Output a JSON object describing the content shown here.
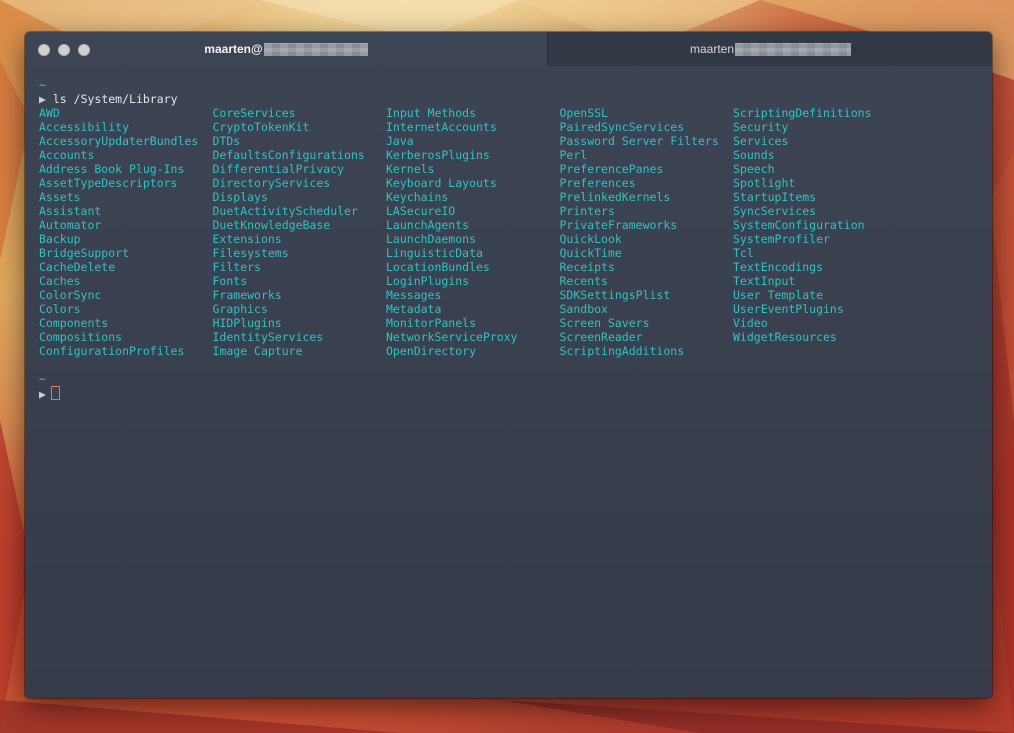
{
  "window": {
    "active_tab_title": "maarten@",
    "inactive_tab_title": "maarten"
  },
  "terminal": {
    "prompt_dir": "~",
    "prompt_symbol": "▶",
    "command": "ls /System/Library",
    "columns": [
      [
        "AWD",
        "Accessibility",
        "AccessoryUpdaterBundles",
        "Accounts",
        "Address Book Plug-Ins",
        "AssetTypeDescriptors",
        "Assets",
        "Assistant",
        "Automator",
        "Backup",
        "BridgeSupport",
        "CacheDelete",
        "Caches",
        "ColorSync",
        "Colors",
        "Components",
        "Compositions",
        "ConfigurationProfiles"
      ],
      [
        "CoreServices",
        "CryptoTokenKit",
        "DTDs",
        "DefaultsConfigurations",
        "DifferentialPrivacy",
        "DirectoryServices",
        "Displays",
        "DuetActivityScheduler",
        "DuetKnowledgeBase",
        "Extensions",
        "Filesystems",
        "Filters",
        "Fonts",
        "Frameworks",
        "Graphics",
        "HIDPlugins",
        "IdentityServices",
        "Image Capture"
      ],
      [
        "Input Methods",
        "InternetAccounts",
        "Java",
        "KerberosPlugins",
        "Kernels",
        "Keyboard Layouts",
        "Keychains",
        "LASecureIO",
        "LaunchAgents",
        "LaunchDaemons",
        "LinguisticData",
        "LocationBundles",
        "LoginPlugins",
        "Messages",
        "Metadata",
        "MonitorPanels",
        "NetworkServiceProxy",
        "OpenDirectory"
      ],
      [
        "OpenSSL",
        "PairedSyncServices",
        "Password Server Filters",
        "Perl",
        "PreferencePanes",
        "Preferences",
        "PrelinkedKernels",
        "Printers",
        "PrivateFrameworks",
        "QuickLook",
        "QuickTime",
        "Receipts",
        "Recents",
        "SDKSettingsPlist",
        "Sandbox",
        "Screen Savers",
        "ScreenReader",
        "ScriptingAdditions"
      ],
      [
        "ScriptingDefinitions",
        "Security",
        "Services",
        "Sounds",
        "Speech",
        "Spotlight",
        "StartupItems",
        "SyncServices",
        "SystemConfiguration",
        "SystemProfiler",
        "Tcl",
        "TextEncodings",
        "TextInput",
        "User Template",
        "UserEventPlugins",
        "Video",
        "WidgetResources"
      ]
    ]
  }
}
